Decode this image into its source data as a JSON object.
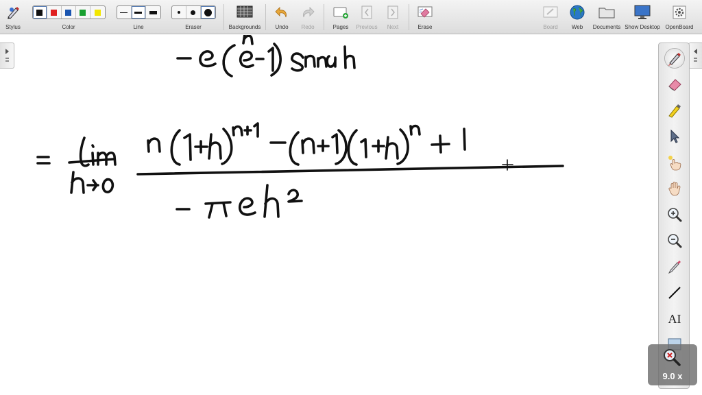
{
  "toolbar": {
    "stylus": "Stylus",
    "color": "Color",
    "line": "Line",
    "eraser": "Eraser",
    "backgrounds": "Backgrounds",
    "undo": "Undo",
    "redo": "Redo",
    "pages": "Pages",
    "previous": "Previous",
    "next": "Next",
    "erase": "Erase",
    "board": "Board",
    "web": "Web",
    "documents": "Documents",
    "show_desktop": "Show Desktop",
    "openboard": "OpenBoard"
  },
  "colors": {
    "swatches": [
      "#111111",
      "#e02020",
      "#1a55b0",
      "#18a030",
      "#f2e600"
    ],
    "ink": "#111111"
  },
  "palette_tools": [
    "pen-tool-icon",
    "eraser-tool-icon",
    "highlighter-icon",
    "pointer-icon",
    "laser-pointer-icon",
    "hand-icon",
    "zoom-in-icon",
    "zoom-out-icon",
    "marker-icon",
    "line-tool-icon",
    "text-tool-icon",
    "capture-icon"
  ],
  "palette": {
    "text_tool": "AI"
  },
  "zoom": {
    "level": "9.0 x"
  }
}
